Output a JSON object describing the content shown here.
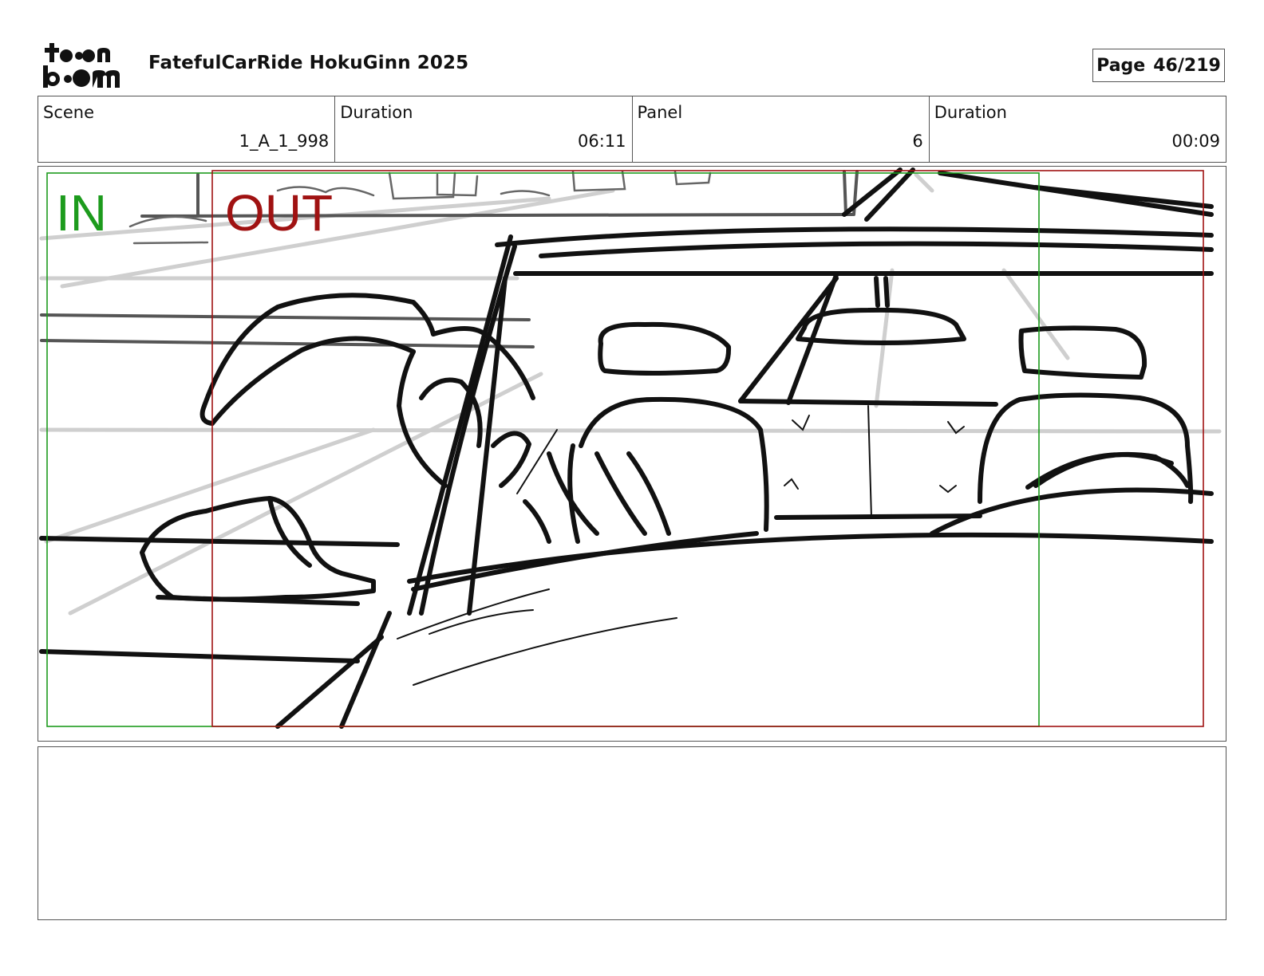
{
  "header": {
    "logo_name": "toon-boom-logo",
    "title": "FatefulCarRide HokuGinn 2025",
    "page_label": "Page",
    "page_value": "46/219"
  },
  "info": {
    "scene_label": "Scene",
    "scene_value": "1_A_1_998",
    "scene_duration_label": "Duration",
    "scene_duration_value": "06:11",
    "panel_label": "Panel",
    "panel_value": "6",
    "panel_duration_label": "Duration",
    "panel_duration_value": "00:09"
  },
  "frame": {
    "in_label": "IN",
    "out_label": "OUT",
    "in_color": "#1d9b1d",
    "out_color": "#a01212"
  },
  "notes": {
    "text": ""
  }
}
